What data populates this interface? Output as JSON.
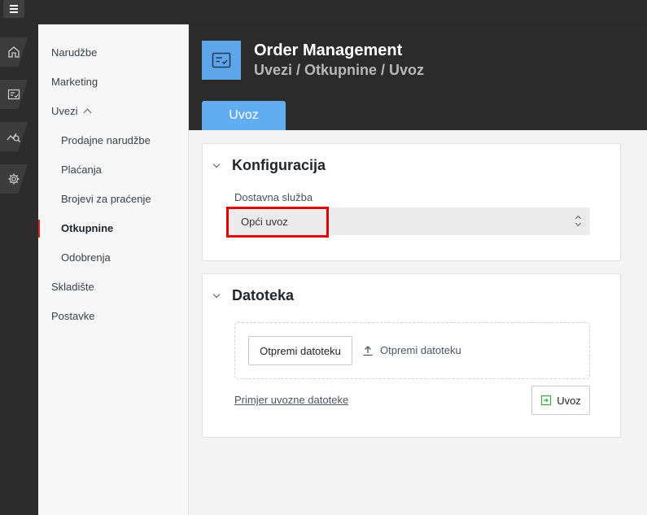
{
  "app": {
    "title": "Order Management",
    "breadcrumb": "Uvezi / Otkupnine / Uvoz"
  },
  "tabs": [
    {
      "label": "Uvoz",
      "active": true
    }
  ],
  "rail": {
    "items": [
      {
        "icon": "home-icon"
      },
      {
        "icon": "checklist-icon"
      },
      {
        "icon": "analytics-icon"
      },
      {
        "icon": "settings-gear-icon"
      }
    ]
  },
  "sidebar": {
    "items": [
      {
        "label": "Narudžbe",
        "level": 1
      },
      {
        "label": "Marketing",
        "level": 1
      },
      {
        "label": "Uvezi",
        "level": 1,
        "expanded": true
      },
      {
        "label": "Prodajne narudžbe",
        "level": 2
      },
      {
        "label": "Plaćanja",
        "level": 2
      },
      {
        "label": "Brojevi za praćenje",
        "level": 2
      },
      {
        "label": "Otkupnine",
        "level": 2,
        "active": true
      },
      {
        "label": "Odobrenja",
        "level": 2
      },
      {
        "label": "Skladište",
        "level": 1
      },
      {
        "label": "Postavke",
        "level": 1
      }
    ]
  },
  "config": {
    "title": "Konfiguracija",
    "field_label": "Dostavna služba",
    "selected_value": "Opći uvoz"
  },
  "file": {
    "title": "Datoteka",
    "choose_button": "Otpremi datoteku",
    "upload_label": "Otpremi datoteku",
    "example_link": "Primjer uvozne datoteke",
    "import_button": "Uvoz"
  },
  "colors": {
    "accent": "#62adf2",
    "app_icon_bg": "#5ea6e9",
    "highlight": "#e00000",
    "header_bg": "#2b2b2b",
    "import_icon": "#3caa3c"
  }
}
